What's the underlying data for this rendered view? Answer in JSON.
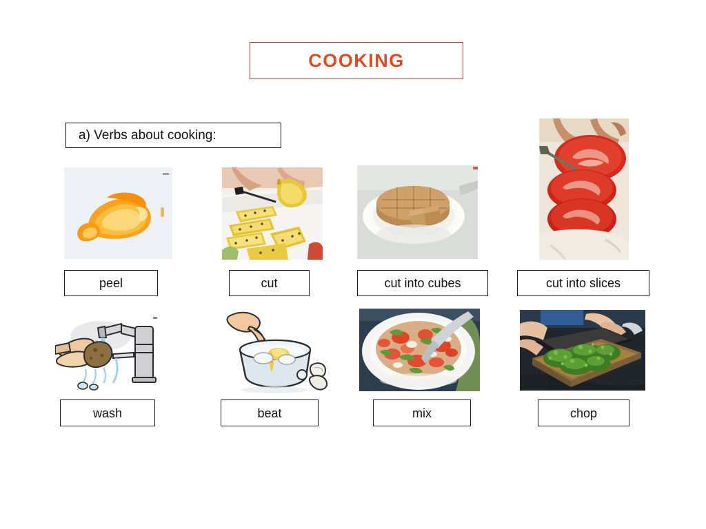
{
  "slide": {
    "title": "COOKING",
    "title_color": "#e04a20",
    "background": "#ffffff"
  },
  "section": {
    "label": "a) Verbs about cooking:"
  },
  "grid": {
    "rows": [
      {
        "items": [
          {
            "label": "peel",
            "image_name": "orange-peel-spiral-photo",
            "image_alt": "Spiral-cut orange peel on a pale background"
          },
          {
            "label": "cut",
            "image_name": "cutting-pineapple-photo",
            "image_alt": "Hands cutting yellow fruit with a knife on a white board"
          },
          {
            "label": "cut into cubes",
            "image_name": "cake-cubes-on-plate-photo",
            "image_alt": "Round brown cake cut into cubes on a white plate"
          },
          {
            "label": "cut into slices",
            "image_name": "tomato-slices-photo",
            "image_alt": "Hand slicing a red tomato into rounds"
          }
        ]
      },
      {
        "items": [
          {
            "label": "wash",
            "image_name": "washing-hands-faucet-clipart",
            "image_alt": "Clip art of hands washing a potato under a tap"
          },
          {
            "label": "beat",
            "image_name": "beating-eggs-bowl-clipart",
            "image_alt": "Clip art of a hand beating eggs with a fork in a bowl"
          },
          {
            "label": "mix",
            "image_name": "mixed-salad-bowl-photo",
            "image_alt": "Tomato salad being mixed with a spoon in a white bowl"
          },
          {
            "label": "chop",
            "image_name": "chopped-herbs-board-photo",
            "image_alt": "Chopped green herbs on a wooden cutting board"
          }
        ]
      }
    ]
  }
}
